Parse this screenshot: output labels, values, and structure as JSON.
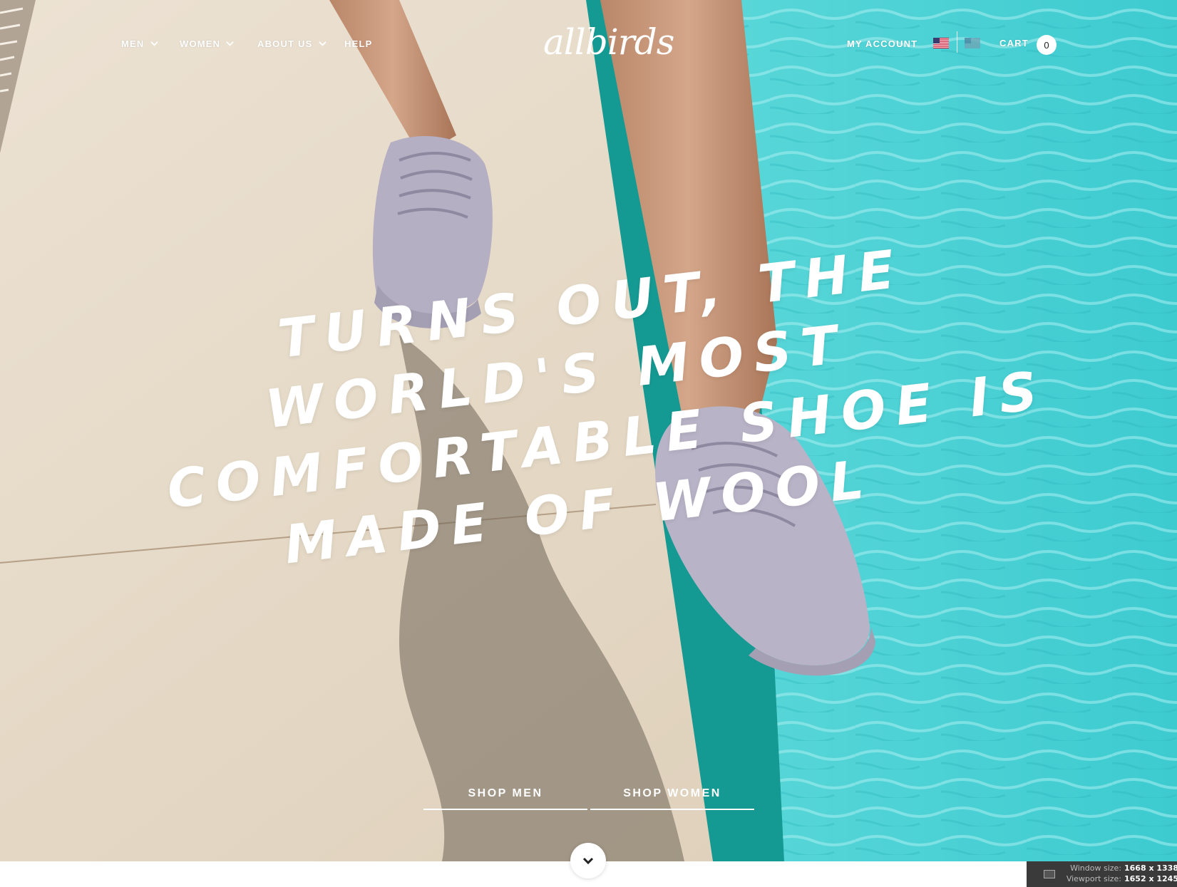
{
  "nav": {
    "items": [
      {
        "label": "MEN",
        "has_dropdown": true
      },
      {
        "label": "WOMEN",
        "has_dropdown": true
      },
      {
        "label": "ABOUT US",
        "has_dropdown": true
      },
      {
        "label": "HELP",
        "has_dropdown": false
      }
    ],
    "logo": "allbirds",
    "account_label": "MY ACCOUNT",
    "cart_label": "CART",
    "cart_count": "0",
    "flags": [
      "us-flag-icon",
      "secondary-flag-icon"
    ]
  },
  "hero": {
    "headline_lines": [
      "TURNS OUT, THE",
      "WORLD'S MOST",
      "COMFORTABLE SHOE IS",
      "MADE OF WOOL"
    ],
    "cta_men": "SHOP MEN",
    "cta_women": "SHOP WOMEN",
    "scroll_icon": "chevron-down-icon"
  },
  "overlay": {
    "window_label": "Window size:",
    "window_value": "1668 x 1338",
    "viewport_label": "Viewport size:",
    "viewport_value": "1652 x 1245"
  },
  "colors": {
    "pool": "#3ccbcf",
    "pool_edge": "#149a93",
    "deck": "#e6d9c6",
    "shoe": "#b5afc3",
    "text": "#ffffff"
  }
}
